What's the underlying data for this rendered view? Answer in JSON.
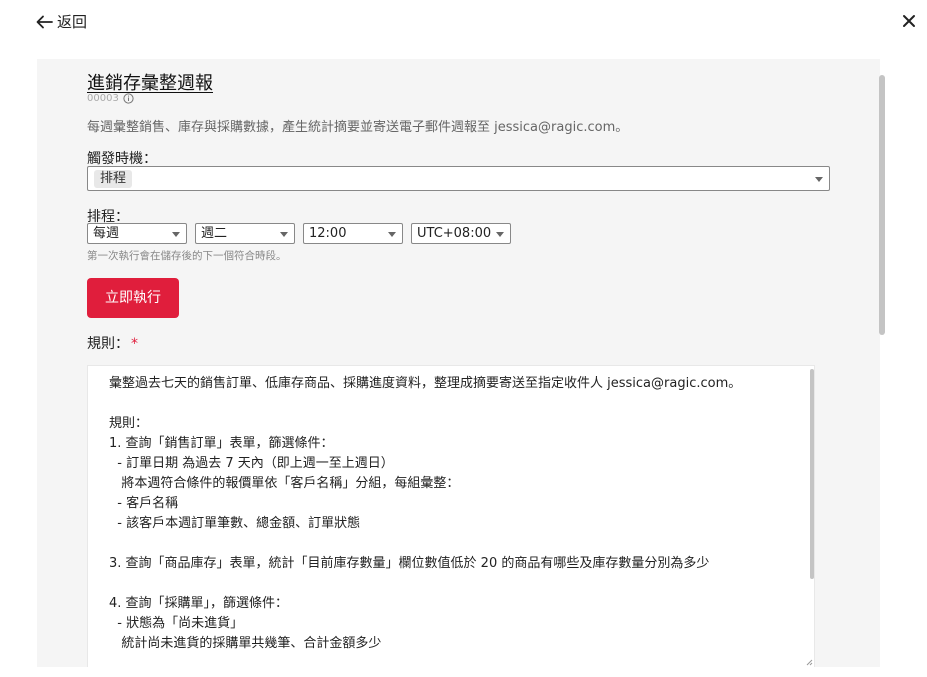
{
  "header": {
    "back_label": "返回"
  },
  "form": {
    "title": "進銷存彙整週報",
    "id": "00003",
    "description": "每週彙整銷售、庫存與採購數據，產生統計摘要並寄送電子郵件週報至 jessica@ragic.com。",
    "trigger_label": "觸發時機：",
    "trigger_value": "排程",
    "schedule_label": "排程：",
    "schedule": {
      "frequency": "每週",
      "day": "週二",
      "time": "12:00",
      "timezone": "UTC+08:00"
    },
    "schedule_hint": "第一次執行會在儲存後的下一個符合時段。",
    "run_button": "立即執行",
    "rules_label": "規則：",
    "required_mark": "*",
    "rules_text": "彙整過去七天的銷售訂單、低庫存商品、採購進度資料，整理成摘要寄送至指定收件人 jessica@ragic.com。\n\n規則：\n1. 查詢「銷售訂單」表單，篩選條件：\n  - 訂單日期 為過去 7 天內（即上週一至上週日）\n   將本週符合條件的報價單依「客戶名稱」分組，每組彙整：\n  - 客戶名稱\n  - 該客戶本週訂單筆數、總金額、訂單狀態\n\n3. 查詢「商品庫存」表單，統計「目前庫存數量」欄位數值低於 20 的商品有哪些及庫存數量分別為多少\n\n4. 查詢「採購單」，篩選條件：\n  - 狀態為「尚未進貨」\n   統計尚未進貨的採購單共幾筆、合計金額多少"
  },
  "icons": {
    "back": "arrow-left-icon",
    "close": "close-icon",
    "info": "info-icon"
  },
  "colors": {
    "accent": "#e01e3c",
    "panel_bg": "#f5f5f5"
  }
}
